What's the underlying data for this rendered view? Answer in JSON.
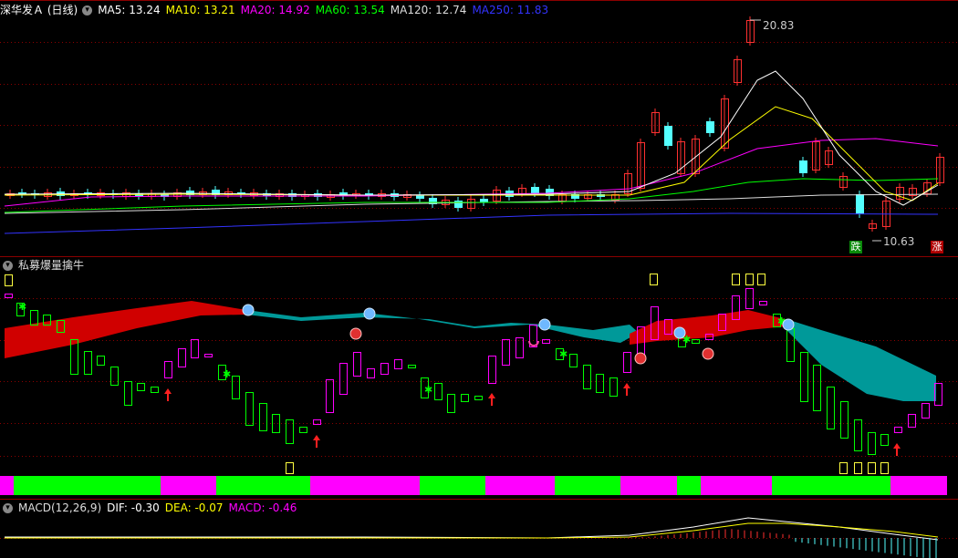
{
  "main_panel": {
    "title": "深华发Ａ (日线)",
    "ma": [
      {
        "label": "MA5: 13.24",
        "color": "#ffffff"
      },
      {
        "label": "MA10: 13.21",
        "color": "#ffff00"
      },
      {
        "label": "MA20: 14.92",
        "color": "#ff00ff"
      },
      {
        "label": "MA60: 13.54",
        "color": "#00ff00"
      },
      {
        "label": "MA120: 12.74",
        "color": "#dddddd"
      },
      {
        "label": "MA250: 11.83",
        "color": "#3333ff"
      }
    ],
    "high_label": "20.83",
    "low_label": "10.63",
    "fall_badge": "跌",
    "rise_badge": "涨"
  },
  "indicator_panel": {
    "title": "私募爆量擒牛"
  },
  "macd_panel": {
    "title": "MACD(12,26,9)",
    "dif": "DIF: -0.30",
    "dea": "DEA: -0.07",
    "macd": "MACD: -0.46"
  },
  "colors": {
    "up": "#ff3030",
    "down": "#54ffff",
    "grid": "#8b0000",
    "band_red": "#d00000",
    "band_teal": "#009999",
    "bar_green": "#00ff00",
    "bar_magenta": "#ff00ff"
  }
}
